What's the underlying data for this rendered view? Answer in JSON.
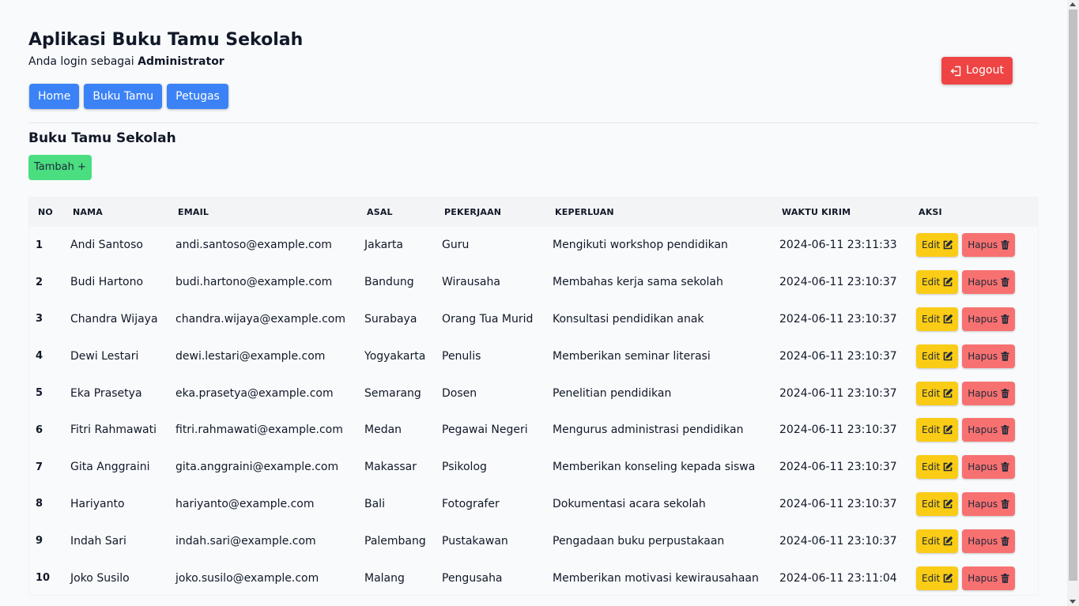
{
  "app": {
    "title": "Aplikasi Buku Tamu Sekolah",
    "login_prefix": "Anda login sebagai ",
    "login_role": "Administrator"
  },
  "nav": [
    {
      "label": "Home"
    },
    {
      "label": "Buku Tamu"
    },
    {
      "label": "Petugas"
    }
  ],
  "logout": {
    "label": "Logout",
    "icon": "logout-icon"
  },
  "section": {
    "title": "Buku Tamu Sekolah",
    "add_label": "Tambah +"
  },
  "table": {
    "headers": [
      "NO",
      "NAMA",
      "EMAIL",
      "ASAL",
      "PEKERJAAN",
      "KEPERLUAN",
      "WAKTU KIRIM",
      "AKSI"
    ],
    "rows": [
      {
        "no": "1",
        "nama": "Andi Santoso",
        "email": "andi.santoso@example.com",
        "asal": "Jakarta",
        "pekerjaan": "Guru",
        "keperluan": "Mengikuti workshop pendidikan",
        "waktu": "2024-06-11 23:11:33"
      },
      {
        "no": "2",
        "nama": "Budi Hartono",
        "email": "budi.hartono@example.com",
        "asal": "Bandung",
        "pekerjaan": "Wirausaha",
        "keperluan": "Membahas kerja sama sekolah",
        "waktu": "2024-06-11 23:10:37"
      },
      {
        "no": "3",
        "nama": "Chandra Wijaya",
        "email": "chandra.wijaya@example.com",
        "asal": "Surabaya",
        "pekerjaan": "Orang Tua Murid",
        "keperluan": "Konsultasi pendidikan anak",
        "waktu": "2024-06-11 23:10:37"
      },
      {
        "no": "4",
        "nama": "Dewi Lestari",
        "email": "dewi.lestari@example.com",
        "asal": "Yogyakarta",
        "pekerjaan": "Penulis",
        "keperluan": "Memberikan seminar literasi",
        "waktu": "2024-06-11 23:10:37"
      },
      {
        "no": "5",
        "nama": "Eka Prasetya",
        "email": "eka.prasetya@example.com",
        "asal": "Semarang",
        "pekerjaan": "Dosen",
        "keperluan": "Penelitian pendidikan",
        "waktu": "2024-06-11 23:10:37"
      },
      {
        "no": "6",
        "nama": "Fitri Rahmawati",
        "email": "fitri.rahmawati@example.com",
        "asal": "Medan",
        "pekerjaan": "Pegawai Negeri",
        "keperluan": "Mengurus administrasi pendidikan",
        "waktu": "2024-06-11 23:10:37"
      },
      {
        "no": "7",
        "nama": "Gita Anggraini",
        "email": "gita.anggraini@example.com",
        "asal": "Makassar",
        "pekerjaan": "Psikolog",
        "keperluan": "Memberikan konseling kepada siswa",
        "waktu": "2024-06-11 23:10:37"
      },
      {
        "no": "8",
        "nama": "Hariyanto",
        "email": "hariyanto@example.com",
        "asal": "Bali",
        "pekerjaan": "Fotografer",
        "keperluan": "Dokumentasi acara sekolah",
        "waktu": "2024-06-11 23:10:37"
      },
      {
        "no": "9",
        "nama": "Indah Sari",
        "email": "indah.sari@example.com",
        "asal": "Palembang",
        "pekerjaan": "Pustakawan",
        "keperluan": "Pengadaan buku perpustakaan",
        "waktu": "2024-06-11 23:10:37"
      },
      {
        "no": "10",
        "nama": "Joko Susilo",
        "email": "joko.susilo@example.com",
        "asal": "Malang",
        "pekerjaan": "Pengusaha",
        "keperluan": "Memberikan motivasi kewirausahaan",
        "waktu": "2024-06-11 23:11:04"
      }
    ],
    "edit_label": "Edit",
    "edit_icon": "edit-icon",
    "delete_label": "Hapus",
    "delete_icon": "trash-icon"
  },
  "colors": {
    "primary": "#3b82f6",
    "danger": "#ef4444",
    "success": "#4ade80",
    "warning": "#facc15",
    "danger_light": "#f87171"
  }
}
